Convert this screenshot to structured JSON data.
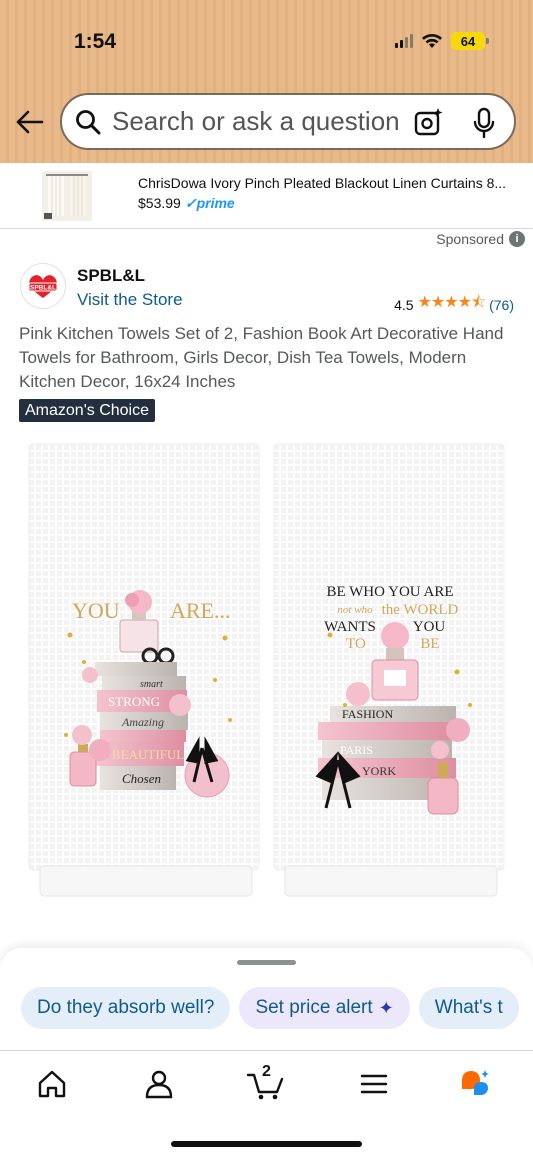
{
  "status": {
    "time": "1:54",
    "battery": "64"
  },
  "search": {
    "placeholder": "Search or ask a question"
  },
  "ad": {
    "title": "ChrisDowa Ivory Pinch Pleated Blackout Linen Curtains 8...",
    "price": "$53.99",
    "prime": "prime"
  },
  "sponsored": {
    "label": "Sponsored",
    "info": "i"
  },
  "seller": {
    "name": "SPBL&L",
    "visit": "Visit the Store",
    "logo_text": "SPBL&L",
    "rating": "4.5",
    "reviews": "(76)",
    "stars": "★★★★⯪"
  },
  "product": {
    "title": "Pink Kitchen Towels Set of 2, Fashion Book Art Decorative Hand Towels for Bathroom, Girls Decor, Dish Tea Towels, Modern Kitchen Decor, 16x24 Inches",
    "badge": "Amazon's Choice"
  },
  "towels": {
    "left": {
      "text_a": "YOU",
      "text_b": "ARE...",
      "books": [
        "smart",
        "STRONG",
        "Amazing",
        "BEAUTIFUL",
        "Chosen"
      ]
    },
    "right": {
      "line1": "BE WHO YOU ARE",
      "line2a": "not who",
      "line2b": "the WORLD",
      "line3a": "WANTS",
      "line3b": "YOU",
      "line4a": "TO",
      "line4b": "BE",
      "books": [
        "FASHION",
        "PARIS",
        "YORK"
      ]
    }
  },
  "chips": [
    "Do they absorb well?",
    "Set price alert",
    "What's t"
  ],
  "cart_count": "2",
  "colors": {
    "header": "#e8b989",
    "link": "#0f5a8c",
    "star": "#f4881c",
    "badge": "#232f3e",
    "chip": "#e3eef9"
  }
}
